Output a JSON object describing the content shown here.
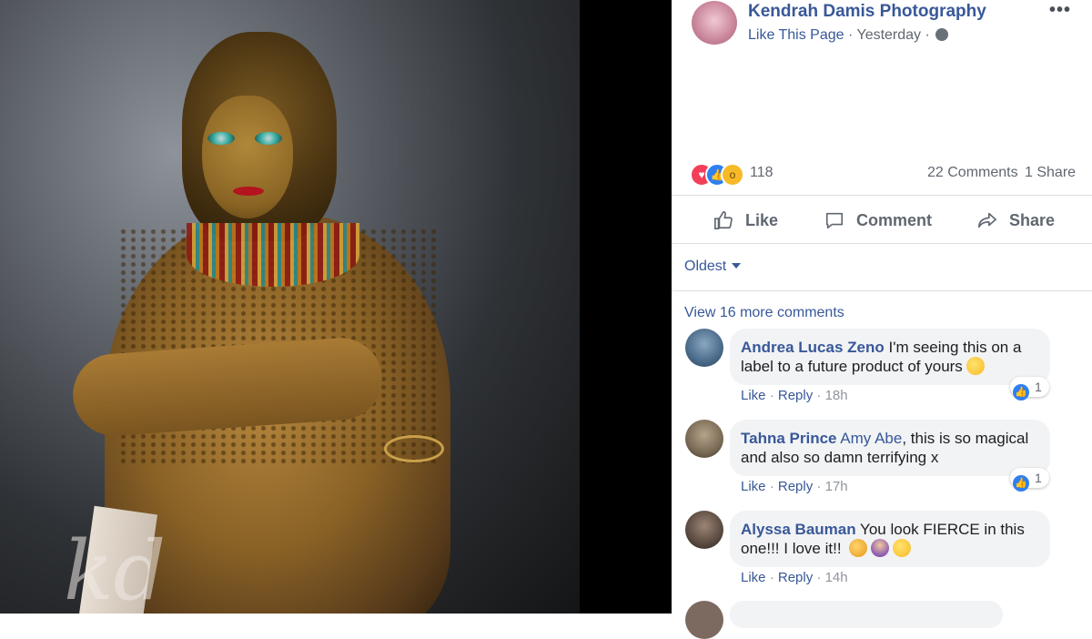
{
  "post": {
    "page_name": "Kendrah Damis Photography",
    "like_page": "Like This Page",
    "separator": "·",
    "time": "Yesterday",
    "more": "•••",
    "watermark": "kd"
  },
  "stats": {
    "reaction_count": "118",
    "comments": "22 Comments",
    "shares": "1 Share"
  },
  "actions": {
    "like": "Like",
    "comment": "Comment",
    "share": "Share"
  },
  "sort": {
    "label": "Oldest"
  },
  "view_more": "View 16 more comments",
  "comments": [
    {
      "author": "Andrea Lucas Zeno",
      "text": "I'm seeing this on a label to a future product of yours",
      "emoji": [
        "wink-emoji"
      ],
      "like": "Like",
      "reply": "Reply",
      "time": "18h",
      "likes": "1",
      "avatar_color": "#4a6a8a"
    },
    {
      "author": "Tahna Prince",
      "tag": "Amy Abe",
      "text": ", this is so magical and also so damn terrifying x",
      "like": "Like",
      "reply": "Reply",
      "time": "17h",
      "likes": "1",
      "avatar_color": "#7a6a55"
    },
    {
      "author": "Alyssa Bauman",
      "text": "You look FIERCE in this one!!! I love it!!",
      "emoji": [
        "flexed-biceps-emoji",
        "woman-emoji",
        "grin-emoji"
      ],
      "like": "Like",
      "reply": "Reply",
      "time": "14h",
      "avatar_color": "#5a4a40"
    }
  ],
  "colors": {
    "link": "#385898",
    "meta": "#616770",
    "bubble": "#f2f3f5",
    "like_blue": "#2e7ff2",
    "love_red": "#f33e58",
    "wow_yellow": "#f7b928"
  }
}
